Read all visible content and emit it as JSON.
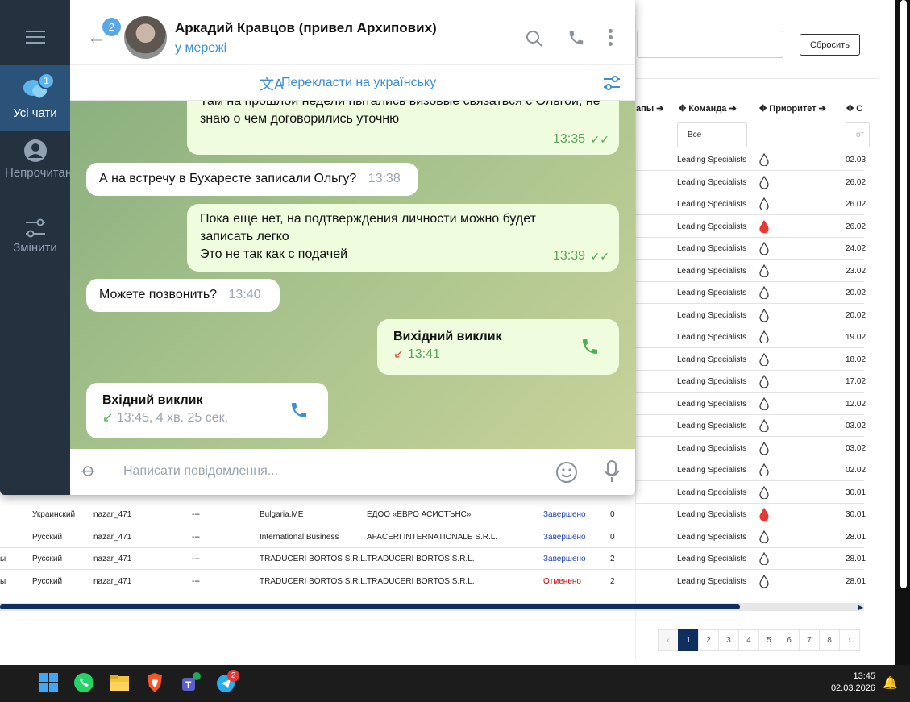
{
  "telegram": {
    "sidebar": {
      "all_chats": "Усі чати",
      "all_badge": "1",
      "unread": "Непрочитано",
      "edit": "Змінити"
    },
    "header": {
      "back_badge": "2",
      "name": "Аркадий Кравцов (привел Архипових)",
      "status": "у мережі"
    },
    "translate_bar": "Перекласти на українську",
    "messages": {
      "m1_text": "Там на прошлой недели пытались визовые связаться с Ольгой, не знаю о чем договорились уточню",
      "m1_time": "13:35",
      "m2_text": "А на встречу в Бухаресте записали Ольгу?",
      "m2_time": "13:38",
      "m3_text": "Пока еще нет, на подтверждения личности можно будет записать легко\nЭто не так как с подачей",
      "m3_time": "13:39",
      "m4_text": "Можете позвонить?",
      "m4_time": "13:40",
      "m5_title": "Вихідний виклик",
      "m5_time": "13:41",
      "m6_title": "Вхідний виклик",
      "m6_time": "13:45, 4 хв. 25 сек."
    },
    "input_placeholder": "Написати повідомлення..."
  },
  "crm": {
    "reset_button": "Сбросить",
    "headers": {
      "etapy": "апы",
      "team": "Команда",
      "priority": "Приоритет",
      "date_initial": "С"
    },
    "team_filter": "Все",
    "date_filter": "от",
    "right_rows": [
      {
        "team": "Leading Specialists",
        "hot": false,
        "date": "02.03"
      },
      {
        "team": "Leading Specialists",
        "hot": false,
        "date": "26.02"
      },
      {
        "team": "Leading Specialists",
        "hot": false,
        "date": "26.02"
      },
      {
        "team": "Leading Specialists",
        "hot": true,
        "date": "26.02"
      },
      {
        "team": "Leading Specialists",
        "hot": false,
        "date": "24.02"
      },
      {
        "team": "Leading Specialists",
        "hot": false,
        "date": "23.02"
      },
      {
        "team": "Leading Specialists",
        "hot": false,
        "date": "20.02"
      },
      {
        "team": "Leading Specialists",
        "hot": false,
        "date": "20.02"
      },
      {
        "team": "Leading Specialists",
        "hot": false,
        "date": "19.02"
      },
      {
        "team": "Leading Specialists",
        "hot": false,
        "date": "18.02"
      },
      {
        "team": "Leading Specialists",
        "hot": false,
        "date": "17.02"
      },
      {
        "team": "Leading Specialists",
        "hot": false,
        "date": "12.02"
      },
      {
        "team": "Leading Specialists",
        "hot": false,
        "date": "03.02"
      },
      {
        "team": "Leading Specialists",
        "hot": false,
        "date": "03.02"
      },
      {
        "team": "Leading Specialists",
        "hot": false,
        "date": "02.02"
      },
      {
        "team": "Leading Specialists",
        "hot": false,
        "date": "30.01"
      }
    ],
    "full_rows": [
      {
        "c0": "",
        "lang": "Украинский",
        "user": "nazar_471",
        "dash": "---",
        "client": "Bulgaria.ME",
        "company": "ЕДОО «ЕВРО АСИСТЪНС»",
        "status": "Завершено",
        "status_color": "#1a3fc2",
        "num": "0",
        "team": "Leading Specialists",
        "hot": true,
        "date": "30.01"
      },
      {
        "c0": "",
        "lang": "Русский",
        "user": "nazar_471",
        "dash": "---",
        "client": "International Business",
        "company": "AFACERI INTERNATIONALE S.R.L.",
        "status": "Завершено",
        "status_color": "#1a3fc2",
        "num": "0",
        "team": "Leading Specialists",
        "hot": false,
        "date": "28.01"
      },
      {
        "c0": "ы",
        "lang": "Русский",
        "user": "nazar_471",
        "dash": "---",
        "client": "TRADUCERI BORTOS S.R.L.",
        "company": "TRADUCERI BORTOS S.R.L.",
        "status": "Завершено",
        "status_color": "#1a3fc2",
        "num": "2",
        "team": "Leading Specialists",
        "hot": false,
        "date": "28.01"
      },
      {
        "c0": "ы",
        "lang": "Русский",
        "user": "nazar_471",
        "dash": "---",
        "client": "TRADUCERI BORTOS S.R.L.",
        "company": "TRADUCERI BORTOS S.R.L.",
        "status": "Отменено",
        "status_color": "#d00000",
        "num": "2",
        "team": "Leading Specialists",
        "hot": false,
        "date": "28.01"
      }
    ],
    "pagination": [
      "‹",
      "1",
      "2",
      "3",
      "4",
      "5",
      "6",
      "7",
      "8",
      "›"
    ]
  },
  "taskbar": {
    "time": "13:45",
    "date": "02.03.2026",
    "telegram_badge": "2"
  }
}
